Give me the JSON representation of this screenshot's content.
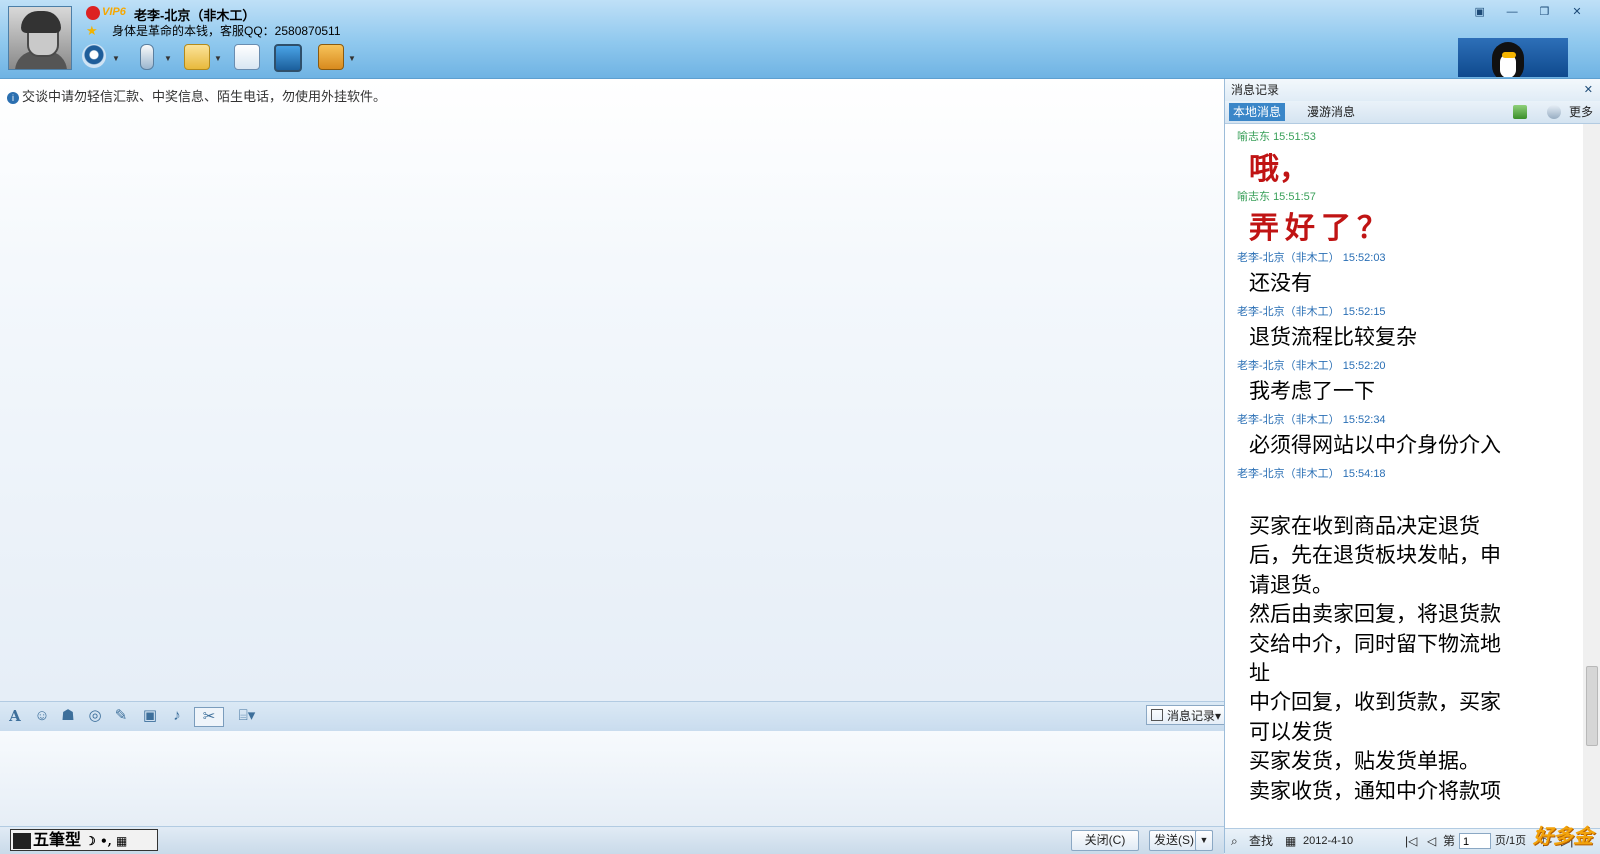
{
  "header": {
    "vip_label": "VIP6",
    "contact_name": "老李-北京（非木工）",
    "signature": "身体是革命的本钱，客服QQ：2580870511"
  },
  "window_controls": [
    "▣",
    "—",
    "❐",
    "✕"
  ],
  "chat": {
    "warning": "交谈中请勿轻信汇款、中奖信息、陌生电话，勿使用外挂软件。"
  },
  "input_toolbar": {
    "history_label": "消息记录"
  },
  "bottom_bar": {
    "ime_label": "五筆型",
    "close_label": "关闭(C)",
    "send_label": "发送(S)"
  },
  "history_panel": {
    "title": "消息记录",
    "close": "✕",
    "tabs": [
      {
        "label": "本地消息",
        "active": true
      },
      {
        "label": "漫游消息",
        "active": false
      }
    ],
    "more_label": "更多",
    "messages": [
      {
        "sender": "喻志东",
        "time": "15:51:53",
        "text": "哦，",
        "style": "red",
        "color": "#3aa05a"
      },
      {
        "sender": "喻志东",
        "time": "15:51:57",
        "text": "弄好了？",
        "style": "red",
        "color": "#3aa05a"
      },
      {
        "sender": "老李-北京（非木工）",
        "time": "15:52:03",
        "text": "还没有",
        "style": "normal",
        "color": "#2a6fb5"
      },
      {
        "sender": "老李-北京（非木工）",
        "time": "15:52:15",
        "text": "退货流程比较复杂",
        "style": "normal",
        "color": "#2a6fb5"
      },
      {
        "sender": "老李-北京（非木工）",
        "time": "15:52:20",
        "text": "我考虑了一下",
        "style": "normal",
        "color": "#2a6fb5"
      },
      {
        "sender": "老李-北京（非木工）",
        "time": "15:52:34",
        "text": "必须得网站以中介身份介入",
        "style": "normal",
        "color": "#2a6fb5"
      },
      {
        "sender": "老李-北京（非木工）",
        "time": "15:54:18",
        "style": "multi",
        "color": "#2a6fb5",
        "lines": [
          "买家在收到商品决定退货",
          "后，先在退货板块发帖，申",
          "请退货。",
          "然后由卖家回复，将退货款",
          "交给中介，同时留下物流地",
          "址",
          "中介回复，收到货款，买家",
          "可以发货",
          "买家发货，贴发货单据。",
          "卖家收货，通知中介将款项"
        ]
      }
    ],
    "bottom": {
      "search_label": "查找",
      "date": "2012-4-10",
      "page_prefix": "第",
      "page_value": "1",
      "page_suffix": "页/1页"
    }
  },
  "watermark": "好多金"
}
